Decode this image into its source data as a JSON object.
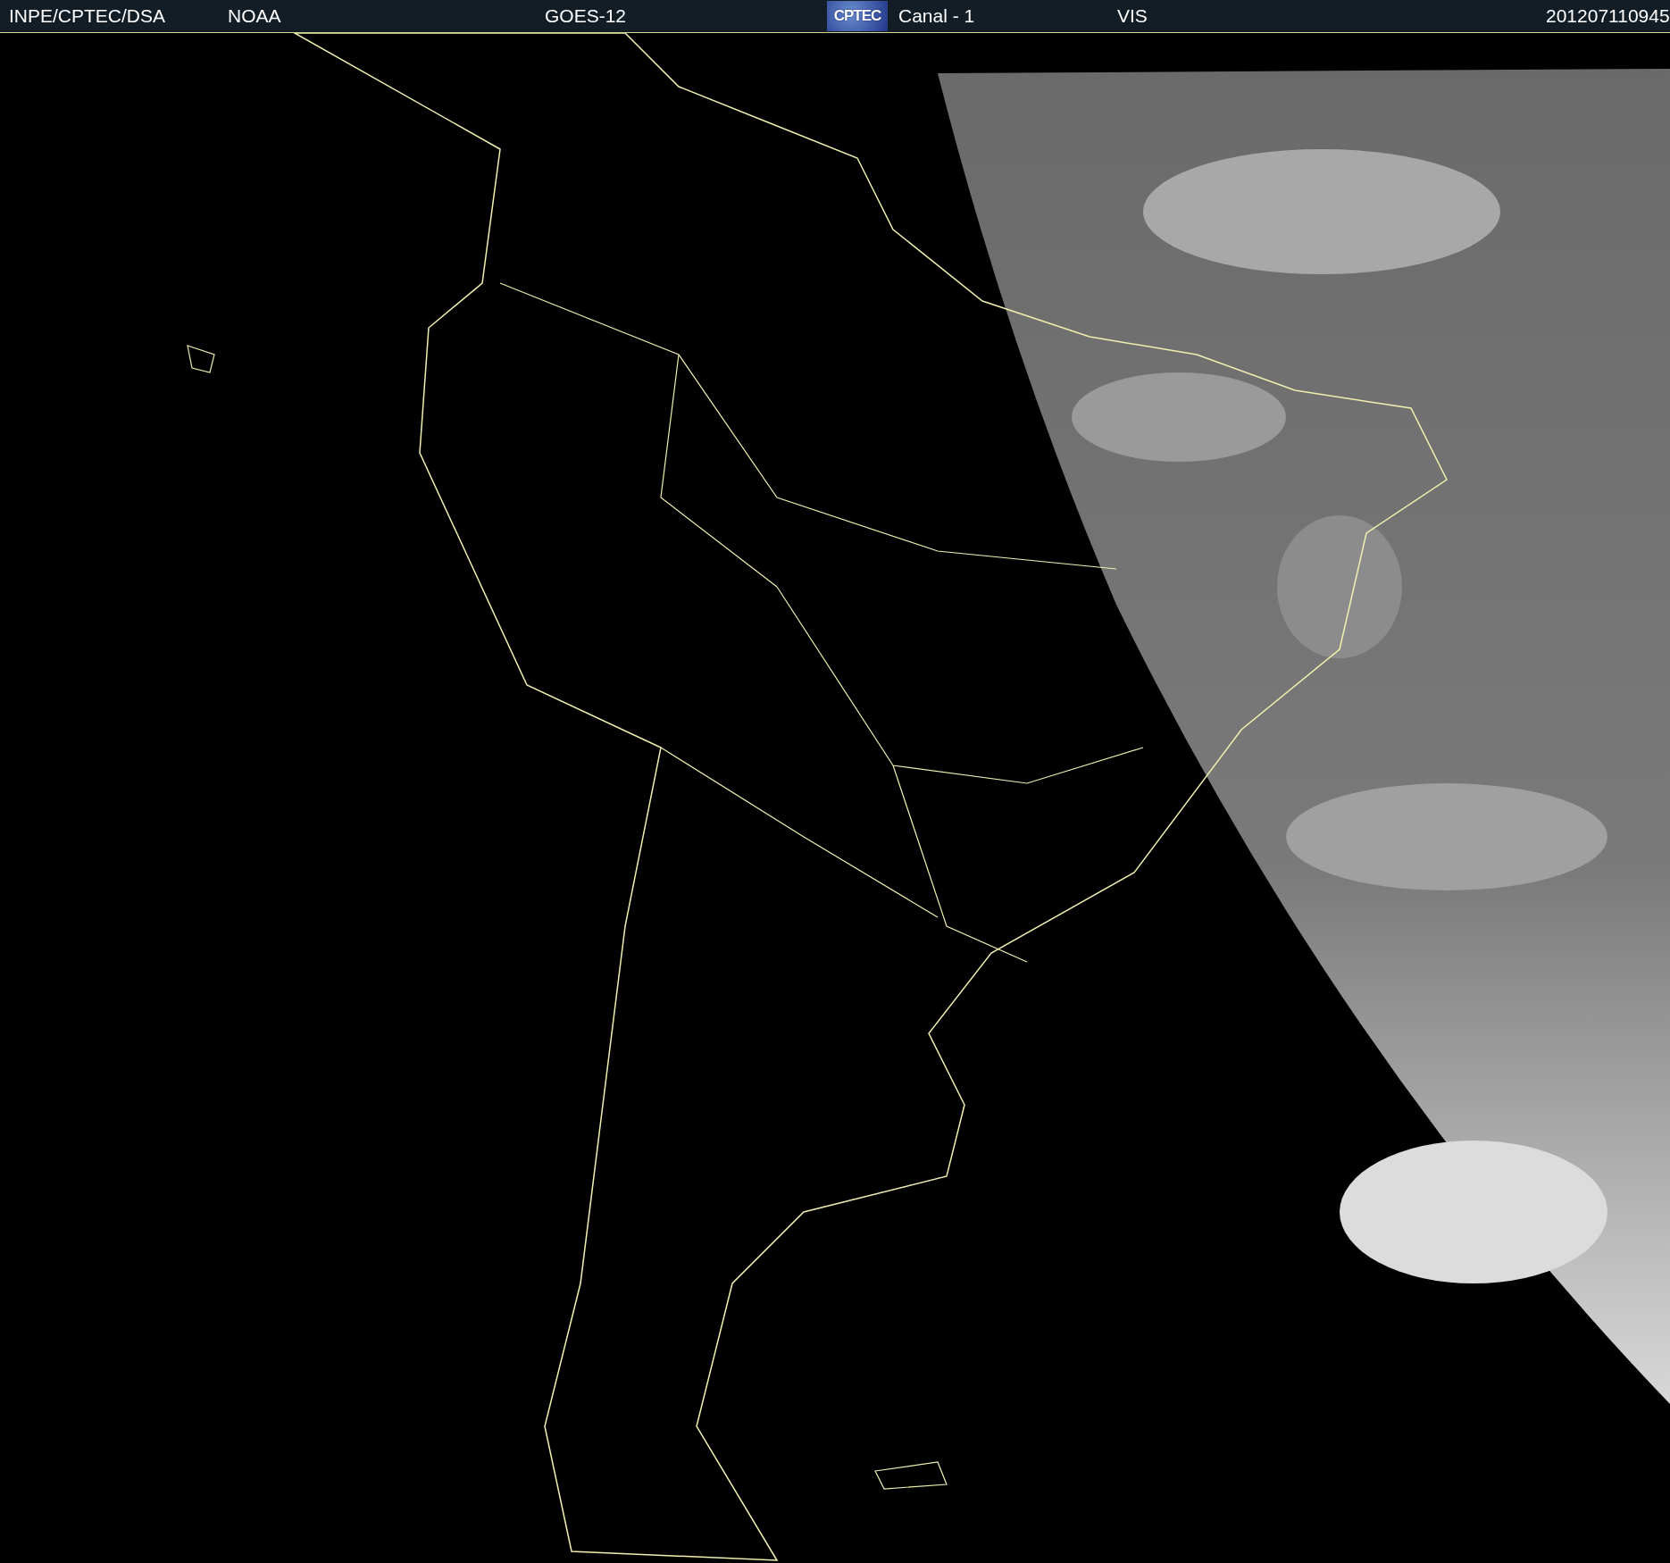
{
  "header": {
    "source": "INPE/CPTEC/DSA",
    "agency": "NOAA",
    "satellite": "GOES-12",
    "logo_text": "CPTEC",
    "channel": "Canal - 1",
    "band": "VIS",
    "timestamp": "201207110945"
  }
}
